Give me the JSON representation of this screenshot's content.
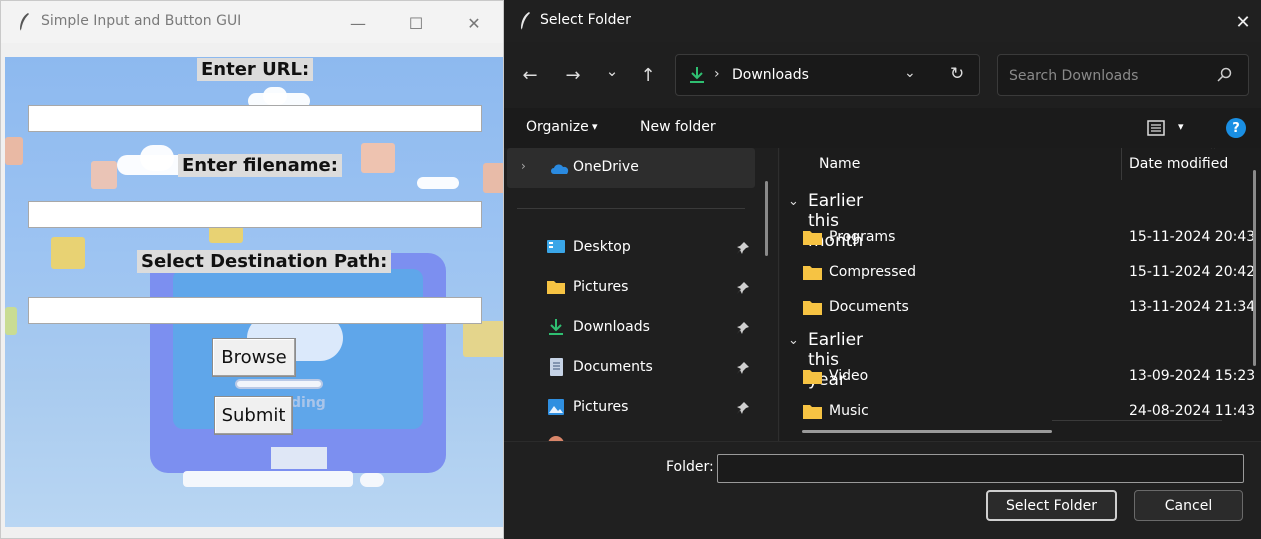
{
  "tk_window": {
    "title": "Simple Input and Button GUI",
    "controls": {
      "minimize": "—",
      "maximize": "☐",
      "close": "✕"
    },
    "url_label": "Enter URL:",
    "url_value": "",
    "filename_label": "Enter filename:",
    "filename_value": "",
    "path_label": "Select Destination Path:",
    "path_value": "",
    "browse_label": "Browse",
    "submit_label": "Submit",
    "background_text": "ding"
  },
  "dialog": {
    "title": "Select Folder",
    "close": "✕",
    "nav": {
      "back": "←",
      "forward": "→",
      "recent": "⌄",
      "up": "↑"
    },
    "address": {
      "separator": "›",
      "current": "Downloads",
      "dropdown": "⌄",
      "refresh": "↻"
    },
    "search": {
      "placeholder": "Search Downloads"
    },
    "toolbar": {
      "organize": "Organize",
      "caret": "▾",
      "new_folder": "New folder",
      "view_caret": "▾",
      "help": "?"
    },
    "navpane": {
      "onedrive": {
        "label": "OneDrive",
        "chevron": "›"
      },
      "quick_access": [
        {
          "label": "Desktop",
          "icon": "desktop-icon"
        },
        {
          "label": "Pictures",
          "icon": "folder-icon"
        },
        {
          "label": "Downloads",
          "icon": "download-icon"
        },
        {
          "label": "Documents",
          "icon": "documents-icon"
        },
        {
          "label": "Pictures",
          "icon": "pictures-icon"
        }
      ]
    },
    "columns": {
      "name": "Name",
      "date": "Date modified",
      "sort_caret": "⌃"
    },
    "groups": [
      {
        "label": "Earlier this month",
        "chevron": "⌄",
        "items": [
          {
            "name": "Programs",
            "date": "15-11-2024 20:43"
          },
          {
            "name": "Compressed",
            "date": "15-11-2024 20:42"
          },
          {
            "name": "Documents",
            "date": "13-11-2024 21:34"
          }
        ]
      },
      {
        "label": "Earlier this year",
        "chevron": "⌄",
        "items": [
          {
            "name": "Video",
            "date": "13-09-2024 15:23"
          },
          {
            "name": "Music",
            "date": "24-08-2024 11:43"
          }
        ]
      }
    ],
    "folder_label": "Folder:",
    "folder_value": "",
    "select_button": "Select Folder",
    "cancel_button": "Cancel",
    "colors": {
      "accent": "#1a8fe3",
      "folder": "#f6c343",
      "download_green": "#2fbf71"
    }
  }
}
